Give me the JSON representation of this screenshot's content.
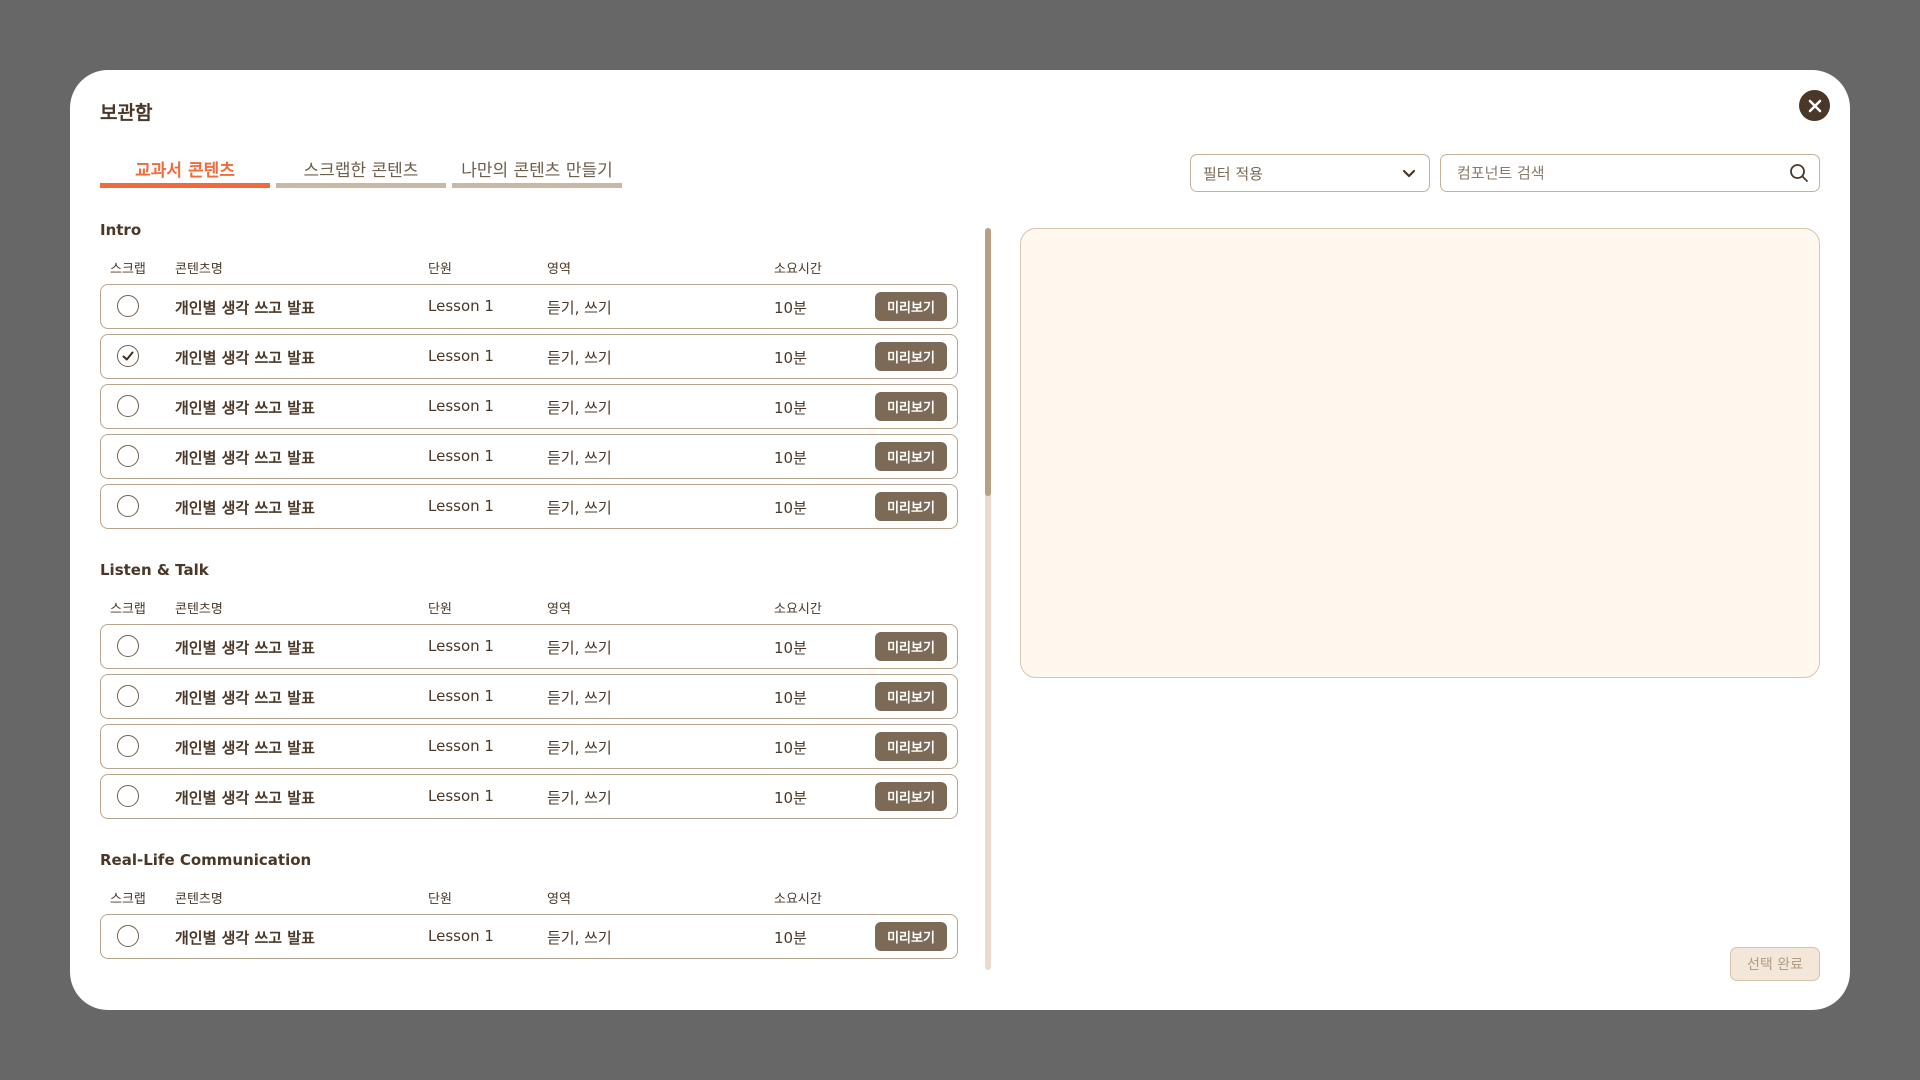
{
  "modal": {
    "title": "보관함",
    "tabs": [
      {
        "label": "교과서 콘텐츠",
        "active": true
      },
      {
        "label": "스크랩한 콘텐츠",
        "active": false
      },
      {
        "label": "나만의 콘텐츠 만들기",
        "active": false
      }
    ],
    "filter_label": "필터 적용",
    "search_placeholder": "컴포넌트 검색",
    "done_label": "선택 완료"
  },
  "columns": {
    "scrap": "스크랩",
    "name": "콘텐츠명",
    "unit": "단원",
    "area": "영역",
    "time": "소요시간"
  },
  "preview_button_label": "미리보기",
  "sections": [
    {
      "title": "Intro",
      "rows": [
        {
          "name": "개인별 생각 쓰고 발표",
          "unit": "Lesson 1",
          "area": "듣기, 쓰기",
          "time": "10분",
          "checked": false
        },
        {
          "name": "개인별 생각 쓰고 발표",
          "unit": "Lesson 1",
          "area": "듣기, 쓰기",
          "time": "10분",
          "checked": true
        },
        {
          "name": "개인별 생각 쓰고 발표",
          "unit": "Lesson 1",
          "area": "듣기, 쓰기",
          "time": "10분",
          "checked": false
        },
        {
          "name": "개인별 생각 쓰고 발표",
          "unit": "Lesson 1",
          "area": "듣기, 쓰기",
          "time": "10분",
          "checked": false
        },
        {
          "name": "개인별 생각 쓰고 발표",
          "unit": "Lesson 1",
          "area": "듣기, 쓰기",
          "time": "10분",
          "checked": false
        }
      ]
    },
    {
      "title": "Listen & Talk",
      "rows": [
        {
          "name": "개인별 생각 쓰고 발표",
          "unit": "Lesson 1",
          "area": "듣기, 쓰기",
          "time": "10분",
          "checked": false
        },
        {
          "name": "개인별 생각 쓰고 발표",
          "unit": "Lesson 1",
          "area": "듣기, 쓰기",
          "time": "10분",
          "checked": false
        },
        {
          "name": "개인별 생각 쓰고 발표",
          "unit": "Lesson 1",
          "area": "듣기, 쓰기",
          "time": "10분",
          "checked": false
        },
        {
          "name": "개인별 생각 쓰고 발표",
          "unit": "Lesson 1",
          "area": "듣기, 쓰기",
          "time": "10분",
          "checked": false
        }
      ]
    },
    {
      "title": "Real-Life Communication",
      "rows": [
        {
          "name": "개인별 생각 쓰고 발표",
          "unit": "Lesson 1",
          "area": "듣기, 쓰기",
          "time": "10분",
          "checked": false
        }
      ]
    }
  ],
  "colors": {
    "accent": "#f06a3b",
    "brown_dark": "#4a3727",
    "preview_bg": "#fef8ef",
    "button_brown": "#7c6a56"
  }
}
